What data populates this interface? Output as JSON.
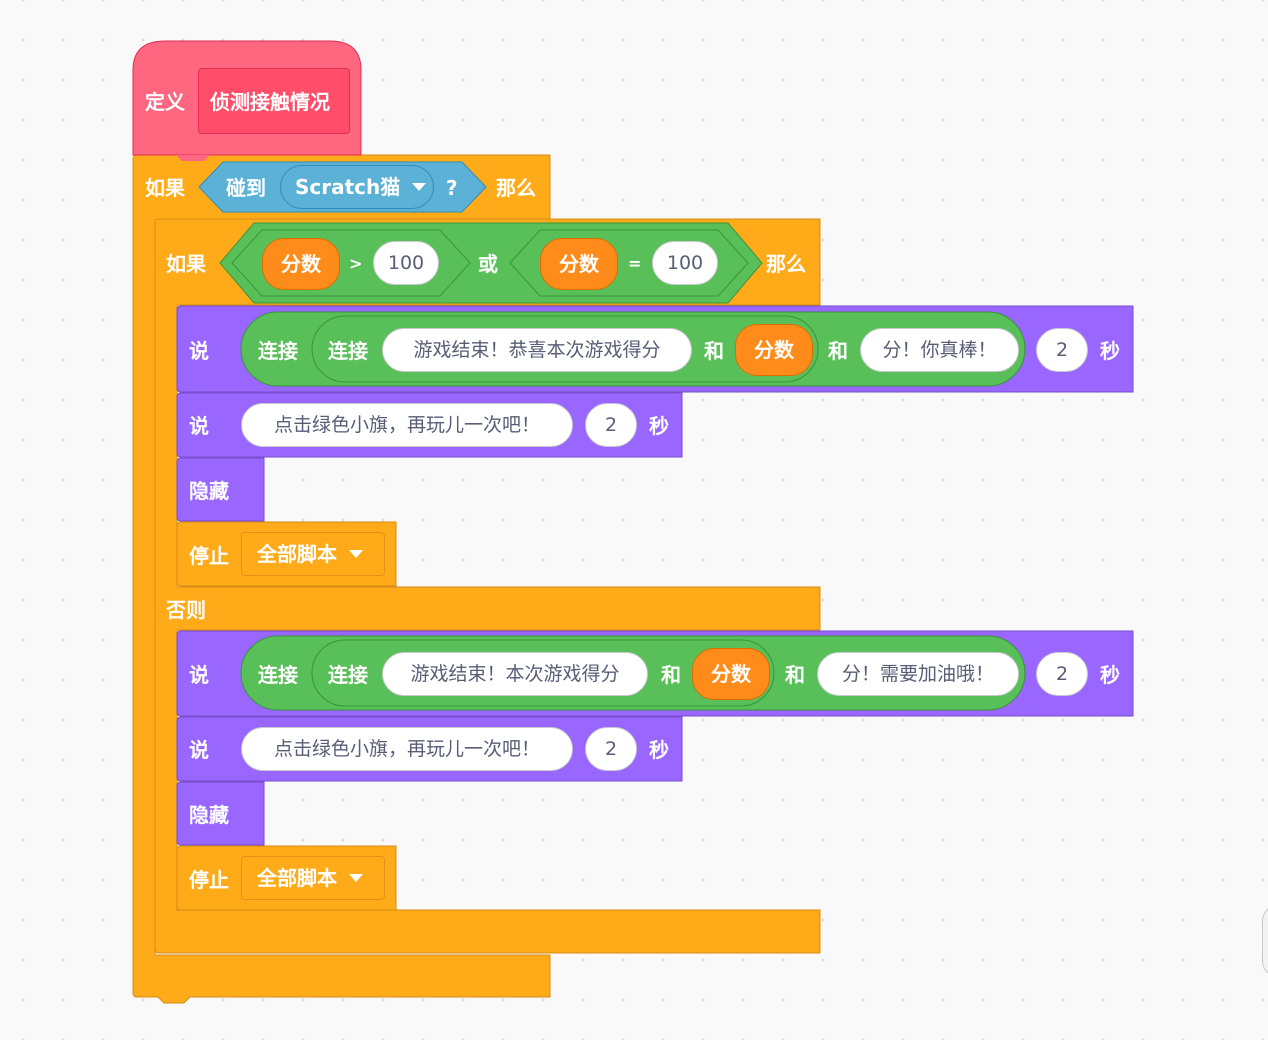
{
  "define_block": {
    "label": "定义",
    "name": "侦测接触情况"
  },
  "outer_if": {
    "if_label": "如果",
    "touching_label": "碰到",
    "touching_target": "Scratch猫",
    "question_mark": "?",
    "then_label": "那么"
  },
  "inner_if": {
    "if_label": "如果",
    "cond_left": {
      "var": "分数",
      "op": ">",
      "value": "100"
    },
    "or_label": "或",
    "cond_right": {
      "var": "分数",
      "op": "=",
      "value": "100"
    },
    "then_label": "那么",
    "else_label": "否则"
  },
  "then_branch": {
    "say1": {
      "say": "说",
      "join1": "连接",
      "join2": "连接",
      "text1": "游戏结束！恭喜本次游戏得分",
      "and1": "和",
      "var": "分数",
      "and2": "和",
      "text2": "分！你真棒！",
      "secs": "2",
      "secs_label": "秒"
    },
    "say2": {
      "say": "说",
      "text": "点击绿色小旗，再玩儿一次吧！",
      "secs": "2",
      "secs_label": "秒"
    },
    "hide": "隐藏",
    "stop": {
      "label": "停止",
      "option": "全部脚本"
    }
  },
  "else_branch": {
    "say1": {
      "say": "说",
      "join1": "连接",
      "join2": "连接",
      "text1": "游戏结束！本次游戏得分",
      "and1": "和",
      "var": "分数",
      "and2": "和",
      "text2": "分！需要加油哦！",
      "secs": "2",
      "secs_label": "秒"
    },
    "say2": {
      "say": "说",
      "text": "点击绿色小旗，再玩儿一次吧！",
      "secs": "2",
      "secs_label": "秒"
    },
    "hide": "隐藏",
    "stop": {
      "label": "停止",
      "option": "全部脚本"
    }
  },
  "colors": {
    "define": "#ff6680",
    "control": "#ffab19",
    "sensing": "#5cb1d6",
    "operators": "#59c059",
    "variables": "#ff8c1a",
    "looks": "#9966ff"
  }
}
